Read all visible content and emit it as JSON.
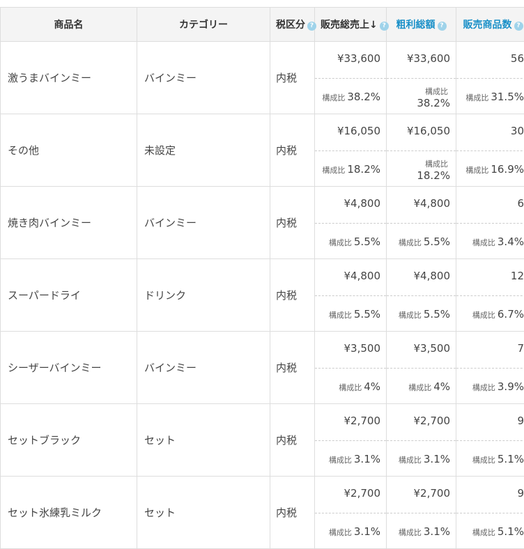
{
  "header": {
    "name": "商品名",
    "category": "カテゴリー",
    "tax": "税区分",
    "sales": "販売総売上↓",
    "profit": "粗利総額",
    "qty": "販売商品数",
    "help_glyph": "?"
  },
  "ratio_label": "構成比",
  "rows": [
    {
      "name": "激うまバインミー",
      "category": "バインミー",
      "tax": "内税",
      "sales": "¥33,600",
      "sales_ratio": "38.2%",
      "profit": "¥33,600",
      "profit_ratio": "38.2%",
      "qty": "56",
      "qty_ratio": "31.5%"
    },
    {
      "name": "その他",
      "category": "未設定",
      "tax": "内税",
      "sales": "¥16,050",
      "sales_ratio": "18.2%",
      "profit": "¥16,050",
      "profit_ratio": "18.2%",
      "qty": "30",
      "qty_ratio": "16.9%"
    },
    {
      "name": "焼き肉バインミー",
      "category": "バインミー",
      "tax": "内税",
      "sales": "¥4,800",
      "sales_ratio": "5.5%",
      "profit": "¥4,800",
      "profit_ratio": "5.5%",
      "qty": "6",
      "qty_ratio": "3.4%"
    },
    {
      "name": "スーパードライ",
      "category": "ドリンク",
      "tax": "内税",
      "sales": "¥4,800",
      "sales_ratio": "5.5%",
      "profit": "¥4,800",
      "profit_ratio": "5.5%",
      "qty": "12",
      "qty_ratio": "6.7%"
    },
    {
      "name": "シーザーバインミー",
      "category": "バインミー",
      "tax": "内税",
      "sales": "¥3,500",
      "sales_ratio": "4%",
      "profit": "¥3,500",
      "profit_ratio": "4%",
      "qty": "7",
      "qty_ratio": "3.9%"
    },
    {
      "name": "セットブラック",
      "category": "セット",
      "tax": "内税",
      "sales": "¥2,700",
      "sales_ratio": "3.1%",
      "profit": "¥2,700",
      "profit_ratio": "3.1%",
      "qty": "9",
      "qty_ratio": "5.1%"
    },
    {
      "name": "セット氷練乳ミルク",
      "category": "セット",
      "tax": "内税",
      "sales": "¥2,700",
      "sales_ratio": "3.1%",
      "profit": "¥2,700",
      "profit_ratio": "3.1%",
      "qty": "9",
      "qty_ratio": "5.1%"
    }
  ]
}
